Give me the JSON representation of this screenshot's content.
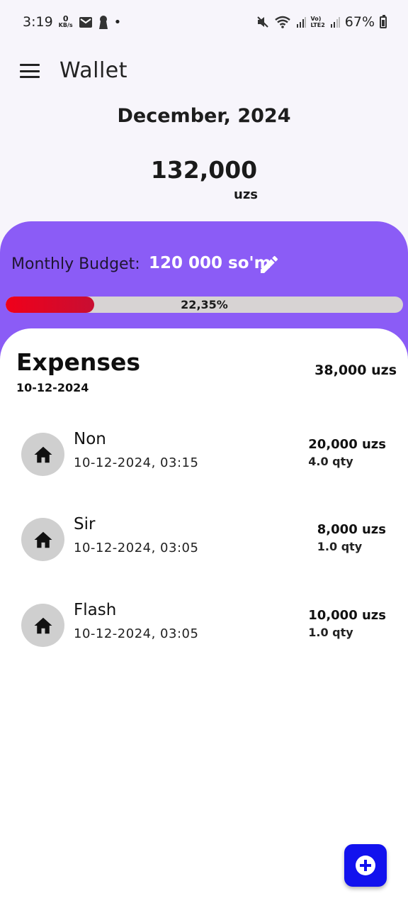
{
  "status_bar": {
    "time": "3:19",
    "kbs_value": "0",
    "kbs_unit": "KB/s",
    "lte_top": "Vo)",
    "lte_bottom": "LTE2",
    "battery": "67%"
  },
  "app_bar": {
    "title": "Wallet"
  },
  "summary": {
    "month": "December, 2024",
    "total": "132,000",
    "total_unit": "uzs"
  },
  "budget": {
    "label": "Monthly Budget:",
    "value": "120 000 so'm",
    "progress_text": "22,35%",
    "progress_fraction": 0.2235,
    "accent_color": "#8b5cf6",
    "bar_color": "#e8001e"
  },
  "expenses": {
    "title": "Expenses",
    "date": "10-12-2024",
    "total": "38,000 uzs",
    "items": [
      {
        "name": "Non",
        "datetime": "10-12-2024, 03:15",
        "amount": "20,000 uzs",
        "qty": "4.0 qty",
        "icon": "home-icon"
      },
      {
        "name": "Sir",
        "datetime": "10-12-2024, 03:05",
        "amount": "8,000 uzs",
        "qty": "1.0 qty",
        "icon": "home-icon"
      },
      {
        "name": "Flash",
        "datetime": "10-12-2024, 03:05",
        "amount": "10,000 uzs",
        "qty": "1.0 qty",
        "icon": "home-icon"
      }
    ]
  },
  "fab": {
    "icon": "add-circle-icon",
    "color": "#1212ee"
  }
}
